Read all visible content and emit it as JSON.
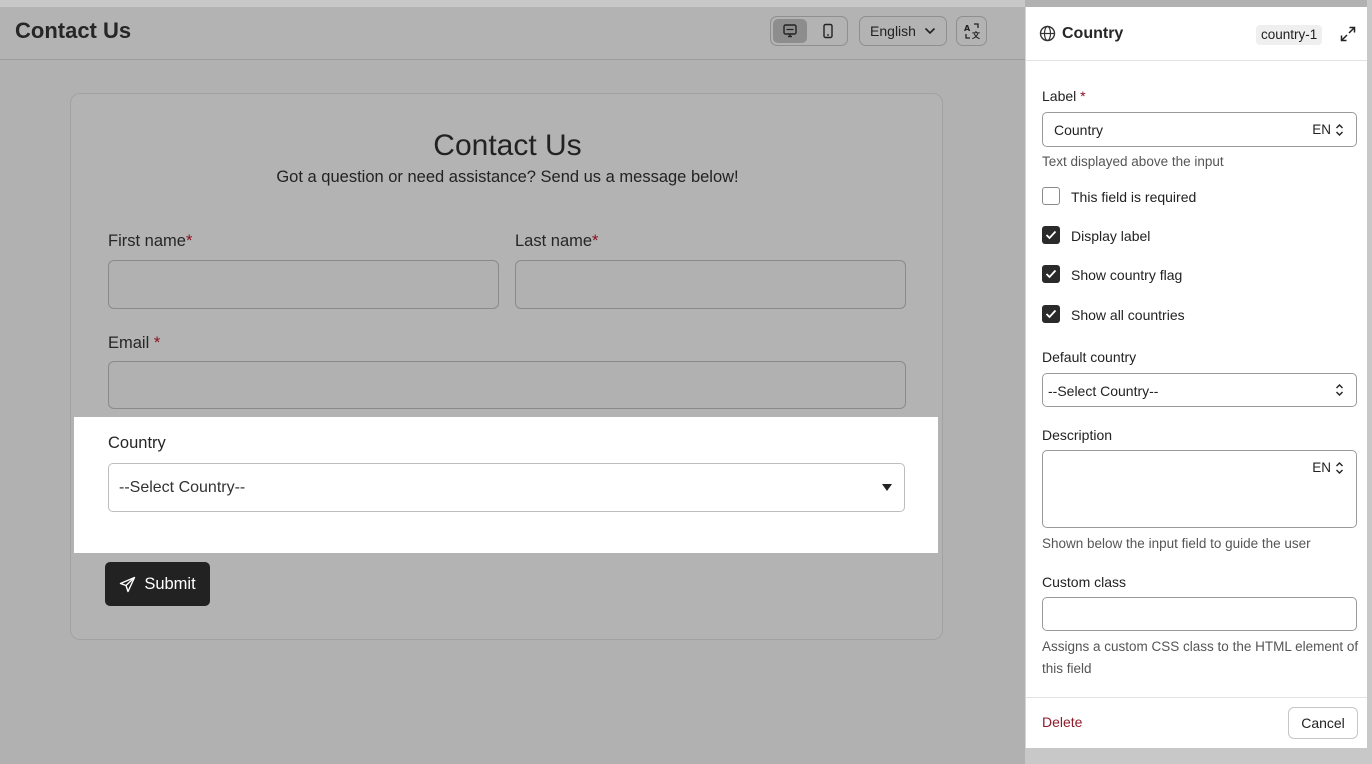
{
  "header": {
    "title": "Contact Us",
    "language": "English"
  },
  "form": {
    "title": "Contact Us",
    "subtitle": "Got a question or need assistance? Send us a message below!",
    "first_name_label": "First name",
    "last_name_label": "Last name",
    "email_label": "Email",
    "required_mark": "*",
    "country_label": "Country",
    "country_value": "--Select Country--",
    "submit_label": "Submit"
  },
  "panel": {
    "title": "Country",
    "field_id": "country-1",
    "label_heading": "Label",
    "label_value": "Country",
    "lang_code": "EN",
    "label_hint": "Text displayed above the input",
    "checkboxes": [
      {
        "label": "This field is required",
        "checked": false
      },
      {
        "label": "Display label",
        "checked": true
      },
      {
        "label": "Show country flag",
        "checked": true
      },
      {
        "label": "Show all countries",
        "checked": true
      }
    ],
    "default_country_heading": "Default country",
    "default_country_value": "--Select Country--",
    "description_heading": "Description",
    "description_value": "",
    "description_hint": "Shown below the input field to guide the user",
    "custom_class_heading": "Custom class",
    "custom_class_value": "",
    "custom_class_hint": "Assigns a custom CSS class to the HTML element of this field",
    "delete_label": "Delete",
    "cancel_label": "Cancel"
  },
  "colors": {
    "overlay": "#b1b1b1",
    "accent_dark": "#222222",
    "required_red": "#8a1020",
    "delete_red": "#8f1b2a"
  },
  "icons": [
    "desktop-icon",
    "mobile-icon",
    "chevron-down-icon",
    "translate-icon",
    "globe-icon",
    "expand-icon",
    "send-icon",
    "check-icon",
    "updown-chevron-icon"
  ]
}
